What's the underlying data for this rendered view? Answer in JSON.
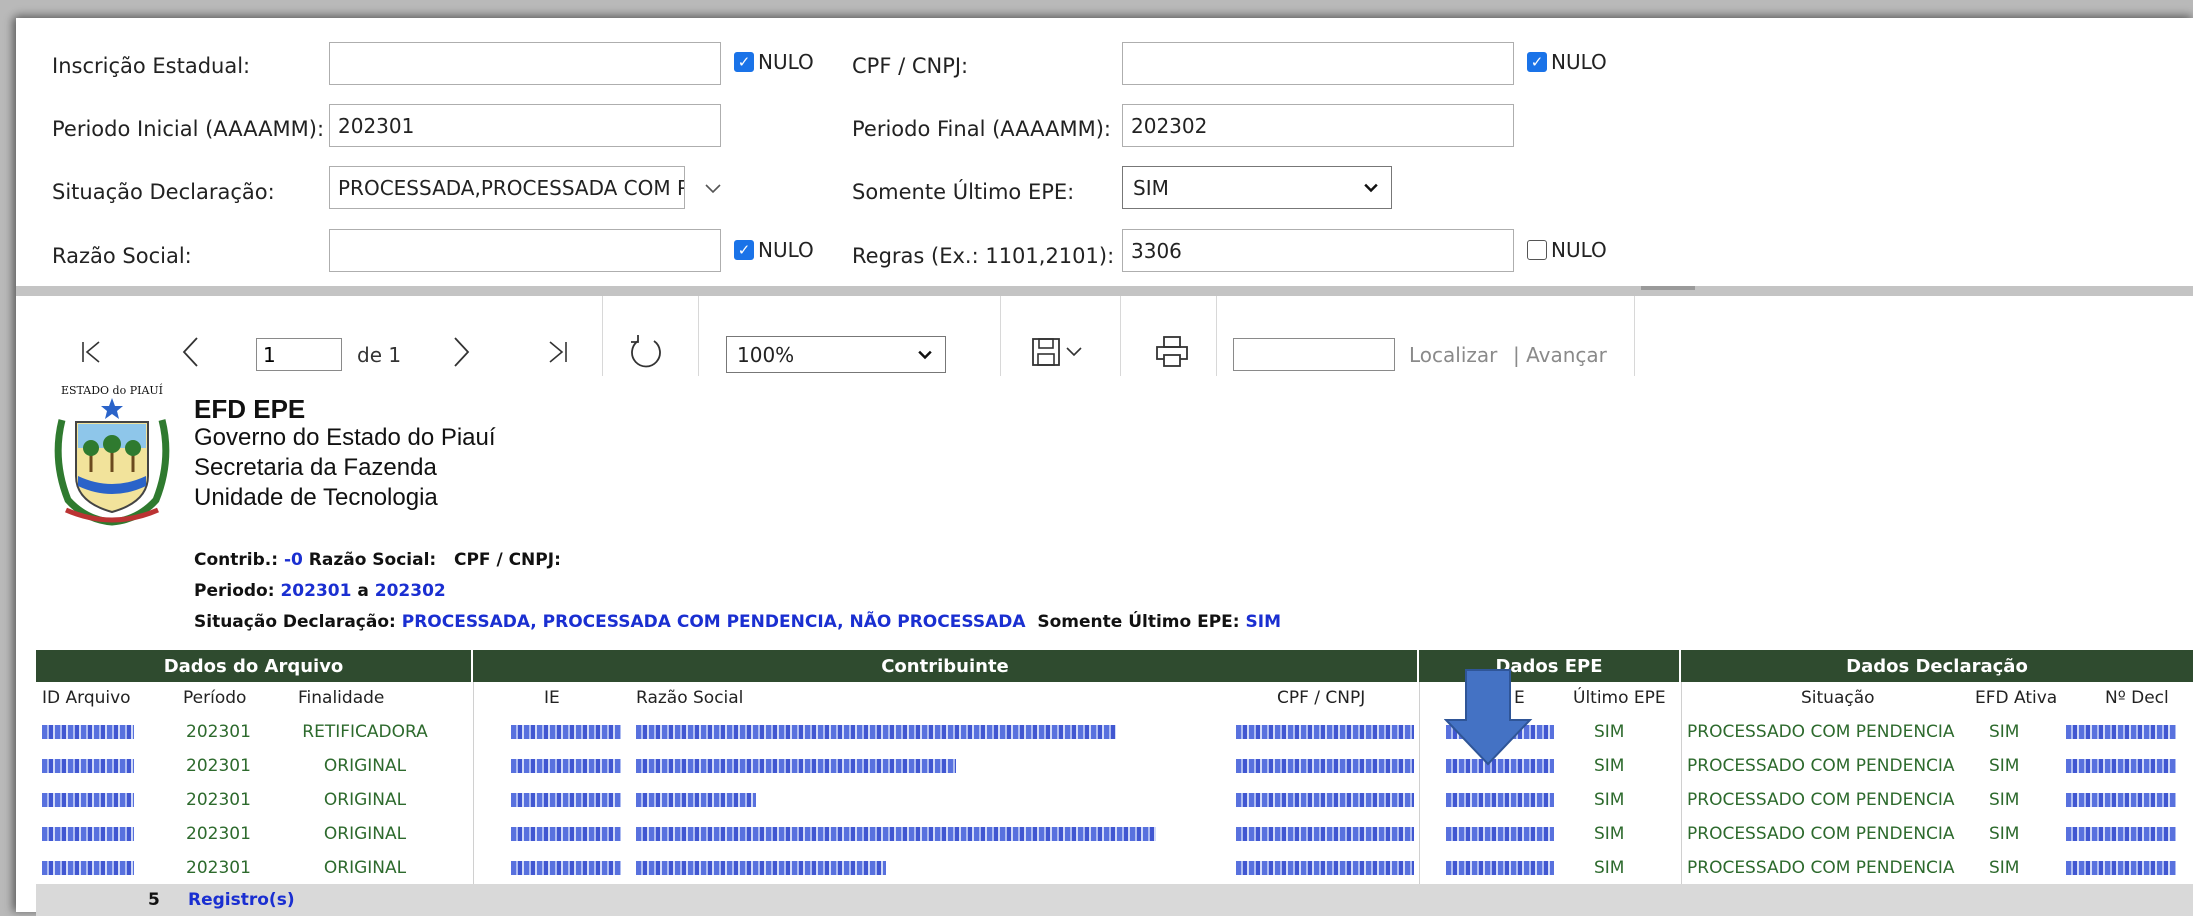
{
  "filters": {
    "inscricao": {
      "label": "Inscrição Estadual:",
      "value": "",
      "nulo_label": "NULO",
      "nulo_checked": true
    },
    "cpf": {
      "label": "CPF / CNPJ:",
      "value": "",
      "nulo_label": "NULO",
      "nulo_checked": true
    },
    "periodo_inicial": {
      "label": "Periodo Inicial (AAAAMM):",
      "value": "202301"
    },
    "periodo_final": {
      "label": "Periodo Final (AAAAMM):",
      "value": "202302"
    },
    "situacao": {
      "label": "Situação Declaração:",
      "value": "PROCESSADA,PROCESSADA COM PENDENCIA,NÃO PROCESSADA"
    },
    "somente_ultimo": {
      "label": "Somente Último EPE:",
      "value": "SIM"
    },
    "razao": {
      "label": "Razão Social:",
      "value": "",
      "nulo_label": "NULO",
      "nulo_checked": true
    },
    "regras": {
      "label": "Regras (Ex.: 1101,2101):",
      "value": "3306",
      "nulo_label": "NULO",
      "nulo_checked": false
    }
  },
  "toolbar": {
    "page": "1",
    "of_label": "de 1",
    "zoom": "100%",
    "find_placeholder": "",
    "find_label": "Localizar",
    "next_label": "| Avançar"
  },
  "report": {
    "title": "EFD EPE",
    "line1": "Governo do Estado do Piauí",
    "line2": "Secretaria da Fazenda",
    "line3": "Unidade de Tecnologia",
    "crit_contrib_label": "Contrib.:",
    "crit_contrib_value": "-0",
    "crit_razao_label": "Razão Social:",
    "crit_cpf_label": "CPF / CNPJ:",
    "crit_periodo_label": "Periodo:",
    "crit_periodo_from": "202301",
    "crit_a": "a",
    "crit_periodo_to": "202302",
    "crit_situacao_label": "Situação Declaração:",
    "crit_situacao_value": "PROCESSADA, PROCESSADA COM PENDENCIA, NÃO PROCESSADA",
    "crit_ultimo_label": "Somente Último EPE:",
    "crit_ultimo_value": "SIM"
  },
  "table": {
    "groups": [
      "Dados do Arquivo",
      "Contribuinte",
      "Dados EPE",
      "Dados Declaração"
    ],
    "headers": [
      "ID Arquivo",
      "Período",
      "Finalidade",
      "IE",
      "Razão Social",
      "CPF / CNPJ",
      "E",
      "Último EPE",
      "Situação",
      "EFD Ativa",
      "Nº Decl"
    ],
    "rows": [
      {
        "periodo": "202301",
        "finalidade": "RETIFICADORA",
        "ultimo": "SIM",
        "situacao": "PROCESSADO COM PENDENCIA",
        "efd": "SIM"
      },
      {
        "periodo": "202301",
        "finalidade": "ORIGINAL",
        "ultimo": "SIM",
        "situacao": "PROCESSADO COM PENDENCIA",
        "efd": "SIM"
      },
      {
        "periodo": "202301",
        "finalidade": "ORIGINAL",
        "ultimo": "SIM",
        "situacao": "PROCESSADO COM PENDENCIA",
        "efd": "SIM"
      },
      {
        "periodo": "202301",
        "finalidade": "ORIGINAL",
        "ultimo": "SIM",
        "situacao": "PROCESSADO COM PENDENCIA",
        "efd": "SIM"
      },
      {
        "periodo": "202301",
        "finalidade": "ORIGINAL",
        "ultimo": "SIM",
        "situacao": "PROCESSADO COM PENDENCIA",
        "efd": "SIM"
      }
    ],
    "footer_count": "5",
    "footer_label": "Registro(s)"
  },
  "colors": {
    "header_green": "#2f4b2f",
    "link_blue": "#1a2fd1",
    "arrow_blue": "#4472c4",
    "check_blue": "#1a73e8"
  }
}
